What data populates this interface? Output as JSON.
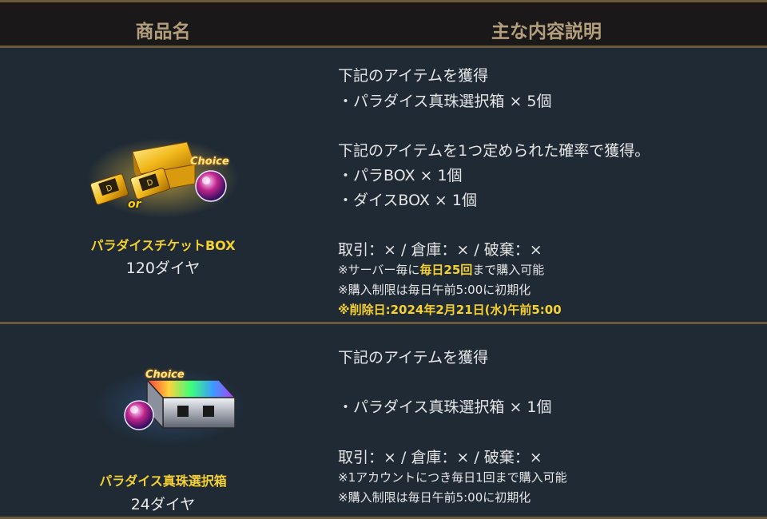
{
  "header": {
    "col_name": "商品名",
    "col_desc": "主な内容説明"
  },
  "products": [
    {
      "name": "パラダイスチケットBOX",
      "price": "120ダイヤ",
      "icon": "gold-ticket-box-icon",
      "art_labels": {
        "choice": "Choice",
        "or": "or"
      },
      "desc": {
        "l1": "下記のアイテムを獲得",
        "l2": "・パラダイス真珠選択箱 × 5個",
        "l3": "下記のアイテムを1つ定められた確率で獲得。",
        "l4": "・パラBOX × 1個",
        "l5": "・ダイスBOX × 1個",
        "trade": "取引：× / 倉庫：× / 破棄：×",
        "limit_prefix": "※サーバー毎に",
        "limit_highlight": "毎日25回",
        "limit_suffix": "まで購入可能",
        "reset": "※購入制限は毎日午前5:00に初期化",
        "delete": "※削除日:2024年2月21日(水)午前5:00"
      }
    },
    {
      "name": "パラダイス真珠選択箱",
      "price": "24ダイヤ",
      "icon": "pearl-selection-box-icon",
      "art_labels": {
        "choice": "Choice"
      },
      "desc": {
        "l1": "下記のアイテムを獲得",
        "l2": "・パラダイス真珠選択箱 × 1個",
        "trade": "取引：× / 倉庫：× / 破棄：×",
        "limit": "※1アカウントにつき毎日1回まで購入可能",
        "reset": "※購入制限は毎日午前5:00に初期化"
      }
    }
  ],
  "colors": {
    "accent": "#f5d031",
    "header_text": "#b39f7c",
    "background": "#1f2a35",
    "divider": "#6a5a3a"
  }
}
